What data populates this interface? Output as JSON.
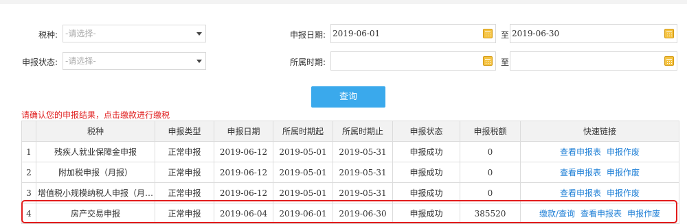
{
  "filters": {
    "tax_type_label": "税种:",
    "tax_type_placeholder": "-请选择-",
    "status_label": "申报状态:",
    "status_placeholder": "-请选择-",
    "declare_date_label": "申报日期:",
    "declare_date_from": "2019-06-01",
    "declare_date_to": "2019-06-30",
    "period_label": "所属时期:",
    "period_from": "",
    "period_to": "",
    "to_label": "至"
  },
  "query_button": "查询",
  "notice": "请确认您的申报结果，点击缴款进行缴税",
  "table": {
    "headers": [
      "",
      "税种",
      "申报类型",
      "申报日期",
      "所属时期起",
      "所属时期止",
      "申报状态",
      "申报税额",
      "快速链接"
    ],
    "rows": [
      {
        "idx": "1",
        "tax": "残疾人就业保障金申报",
        "type": "正常申报",
        "date": "2019-06-12",
        "start": "2019-05-01",
        "end": "2019-05-31",
        "status": "申报成功",
        "amount": "0",
        "links": [
          "查看申报表",
          "申报作废"
        ]
      },
      {
        "idx": "2",
        "tax": "附加税申报（月报）",
        "type": "正常申报",
        "date": "2019-06-12",
        "start": "2019-05-01",
        "end": "2019-05-31",
        "status": "申报成功",
        "amount": "0",
        "links": [
          "查看申报表",
          "申报作废"
        ]
      },
      {
        "idx": "3",
        "tax": "增值税小规模纳税人申报（月…",
        "type": "正常申报",
        "date": "2019-06-12",
        "start": "2019-05-01",
        "end": "2019-05-31",
        "status": "申报成功",
        "amount": "0",
        "links": [
          "查看申报表",
          "申报作废"
        ]
      },
      {
        "idx": "4",
        "tax": "房产交易申报",
        "type": "正常申报",
        "date": "2019-06-04",
        "start": "2019-06-01",
        "end": "2019-06-30",
        "status": "申报成功",
        "amount": "385520",
        "links": [
          "缴款/查询",
          "查看申报表",
          "申报作废"
        ]
      }
    ]
  },
  "colors": {
    "primary_button": "#3aa9ec",
    "link": "#1e7fd6",
    "notice": "#e02020",
    "highlight_border": "#e21b1b"
  },
  "icons": [
    "chevron-down-icon",
    "calendar-icon"
  ]
}
